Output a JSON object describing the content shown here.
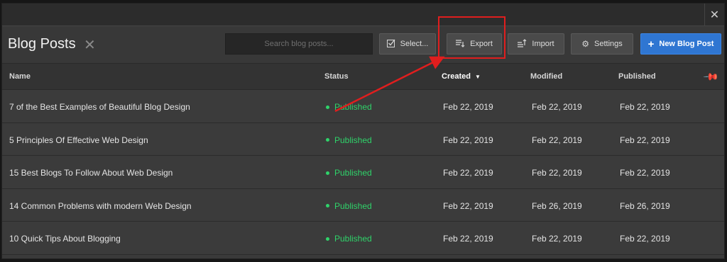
{
  "window": {
    "close_glyph": "✕"
  },
  "header": {
    "title": "Blog Posts",
    "close_glyph": "✕",
    "search": {
      "placeholder": "Search blog posts...",
      "value": ""
    },
    "buttons": {
      "select": "Select...",
      "export": "Export",
      "import": "Import",
      "settings": "Settings",
      "new_post": "New Blog Post"
    },
    "accent_color": "#2f76d2"
  },
  "annotation": {
    "highlight_color": "#e01e1e",
    "target": "Export"
  },
  "table": {
    "columns": [
      "Name",
      "Status",
      "Created",
      "Modified",
      "Published"
    ],
    "sorted_by": "Created",
    "rows": [
      {
        "name": "7 of the Best Examples of Beautiful Blog Design",
        "status": "Published",
        "created": "Feb 22, 2019",
        "modified": "Feb 22, 2019",
        "published": "Feb 22, 2019"
      },
      {
        "name": "5 Principles Of Effective Web Design",
        "status": "Published",
        "created": "Feb 22, 2019",
        "modified": "Feb 22, 2019",
        "published": "Feb 22, 2019"
      },
      {
        "name": "15 Best Blogs To Follow About Web Design",
        "status": "Published",
        "created": "Feb 22, 2019",
        "modified": "Feb 22, 2019",
        "published": "Feb 22, 2019"
      },
      {
        "name": "14 Common Problems with modern Web Design",
        "status": "Published",
        "created": "Feb 22, 2019",
        "modified": "Feb 26, 2019",
        "published": "Feb 26, 2019"
      },
      {
        "name": "10 Quick Tips About Blogging",
        "status": "Published",
        "created": "Feb 22, 2019",
        "modified": "Feb 22, 2019",
        "published": "Feb 22, 2019"
      }
    ],
    "status_color": "#2fd36a"
  },
  "icons": {
    "select": "checkbox-icon",
    "export": "export-icon",
    "import": "import-icon",
    "settings": "gear-icon",
    "new_post": "plus-icon",
    "pin": "pin-icon"
  }
}
